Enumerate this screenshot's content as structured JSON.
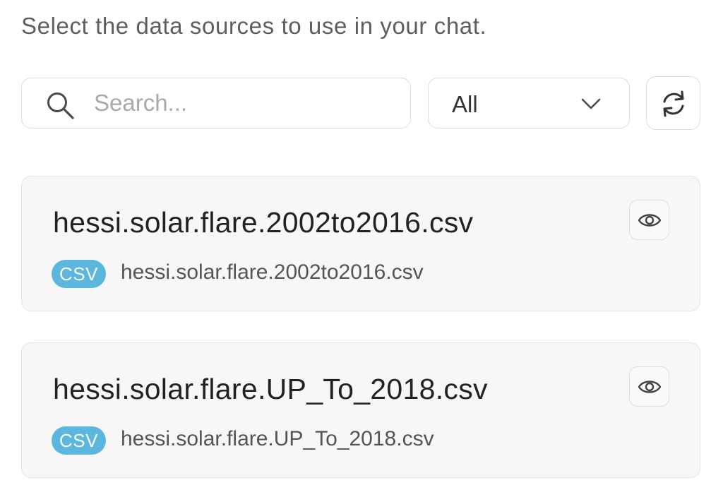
{
  "header": {
    "instruction": "Select the data sources to use in your chat."
  },
  "toolbar": {
    "search": {
      "placeholder": "Search...",
      "value": "",
      "icon": "search-icon"
    },
    "filter": {
      "selected": "All",
      "icon": "chevron-down-icon"
    },
    "refresh": {
      "icon": "refresh-icon"
    }
  },
  "sources": [
    {
      "title": "hessi.solar.flare.2002to2016.csv",
      "badge": "CSV",
      "filename": "hessi.solar.flare.2002to2016.csv",
      "action_icon": "eye-icon"
    },
    {
      "title": "hessi.solar.flare.UP_To_2018.csv",
      "badge": "CSV",
      "filename": "hessi.solar.flare.UP_To_2018.csv",
      "action_icon": "eye-icon"
    }
  ],
  "colors": {
    "badge_bg": "#5bb7dd",
    "card_bg": "#f7f7f7",
    "border": "#dcdcdc",
    "muted_text": "#5e5e5e"
  }
}
